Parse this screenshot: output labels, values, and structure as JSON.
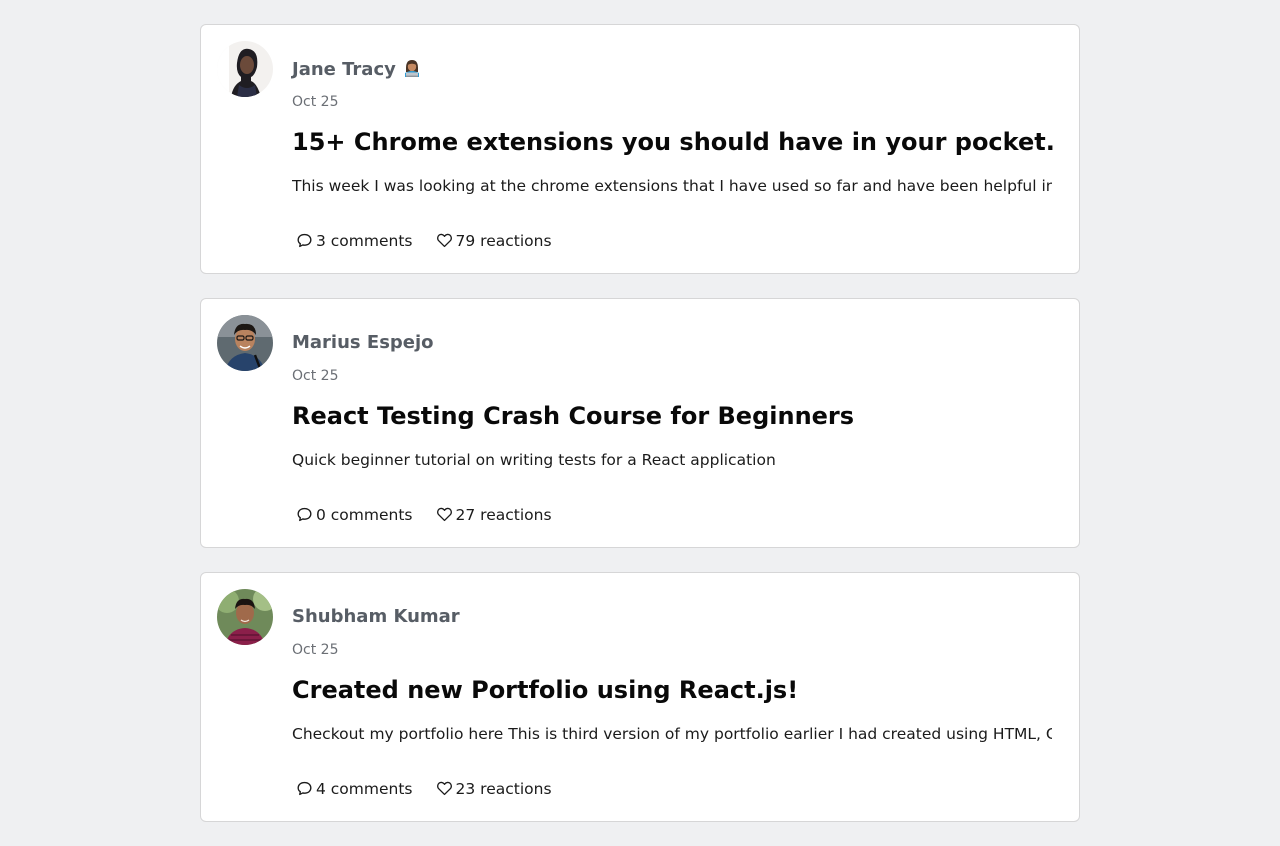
{
  "posts": [
    {
      "author": "Jane Tracy",
      "author_emoji": "👩🏽‍💻",
      "date": "Oct 25",
      "title": "15+ Chrome extensions you should have in your pocket.",
      "excerpt": "This week I was looking at the chrome extensions that I have used so far and have been helpful in my...",
      "comments": "3 comments",
      "reactions": "79 reactions"
    },
    {
      "author": "Marius Espejo",
      "date": "Oct 25",
      "title": "React Testing Crash Course for Beginners",
      "excerpt": "Quick beginner tutorial on writing tests for a React application",
      "comments": "0 comments",
      "reactions": "27 reactions"
    },
    {
      "author": "Shubham Kumar",
      "date": "Oct 25",
      "title": "Created new Portfolio using React.js!",
      "excerpt": "Checkout my portfolio here This is third version of my portfolio earlier I had created using HTML, CS...",
      "comments": "4 comments",
      "reactions": "23 reactions"
    }
  ],
  "icons": {
    "comment": "comment-icon",
    "reaction": "heart-icon"
  },
  "colors": {
    "background": "#eff0f2",
    "card": "#ffffff",
    "card_border": "#d6d6d7",
    "author_text": "#575d65",
    "date_text": "#6b6f75"
  }
}
